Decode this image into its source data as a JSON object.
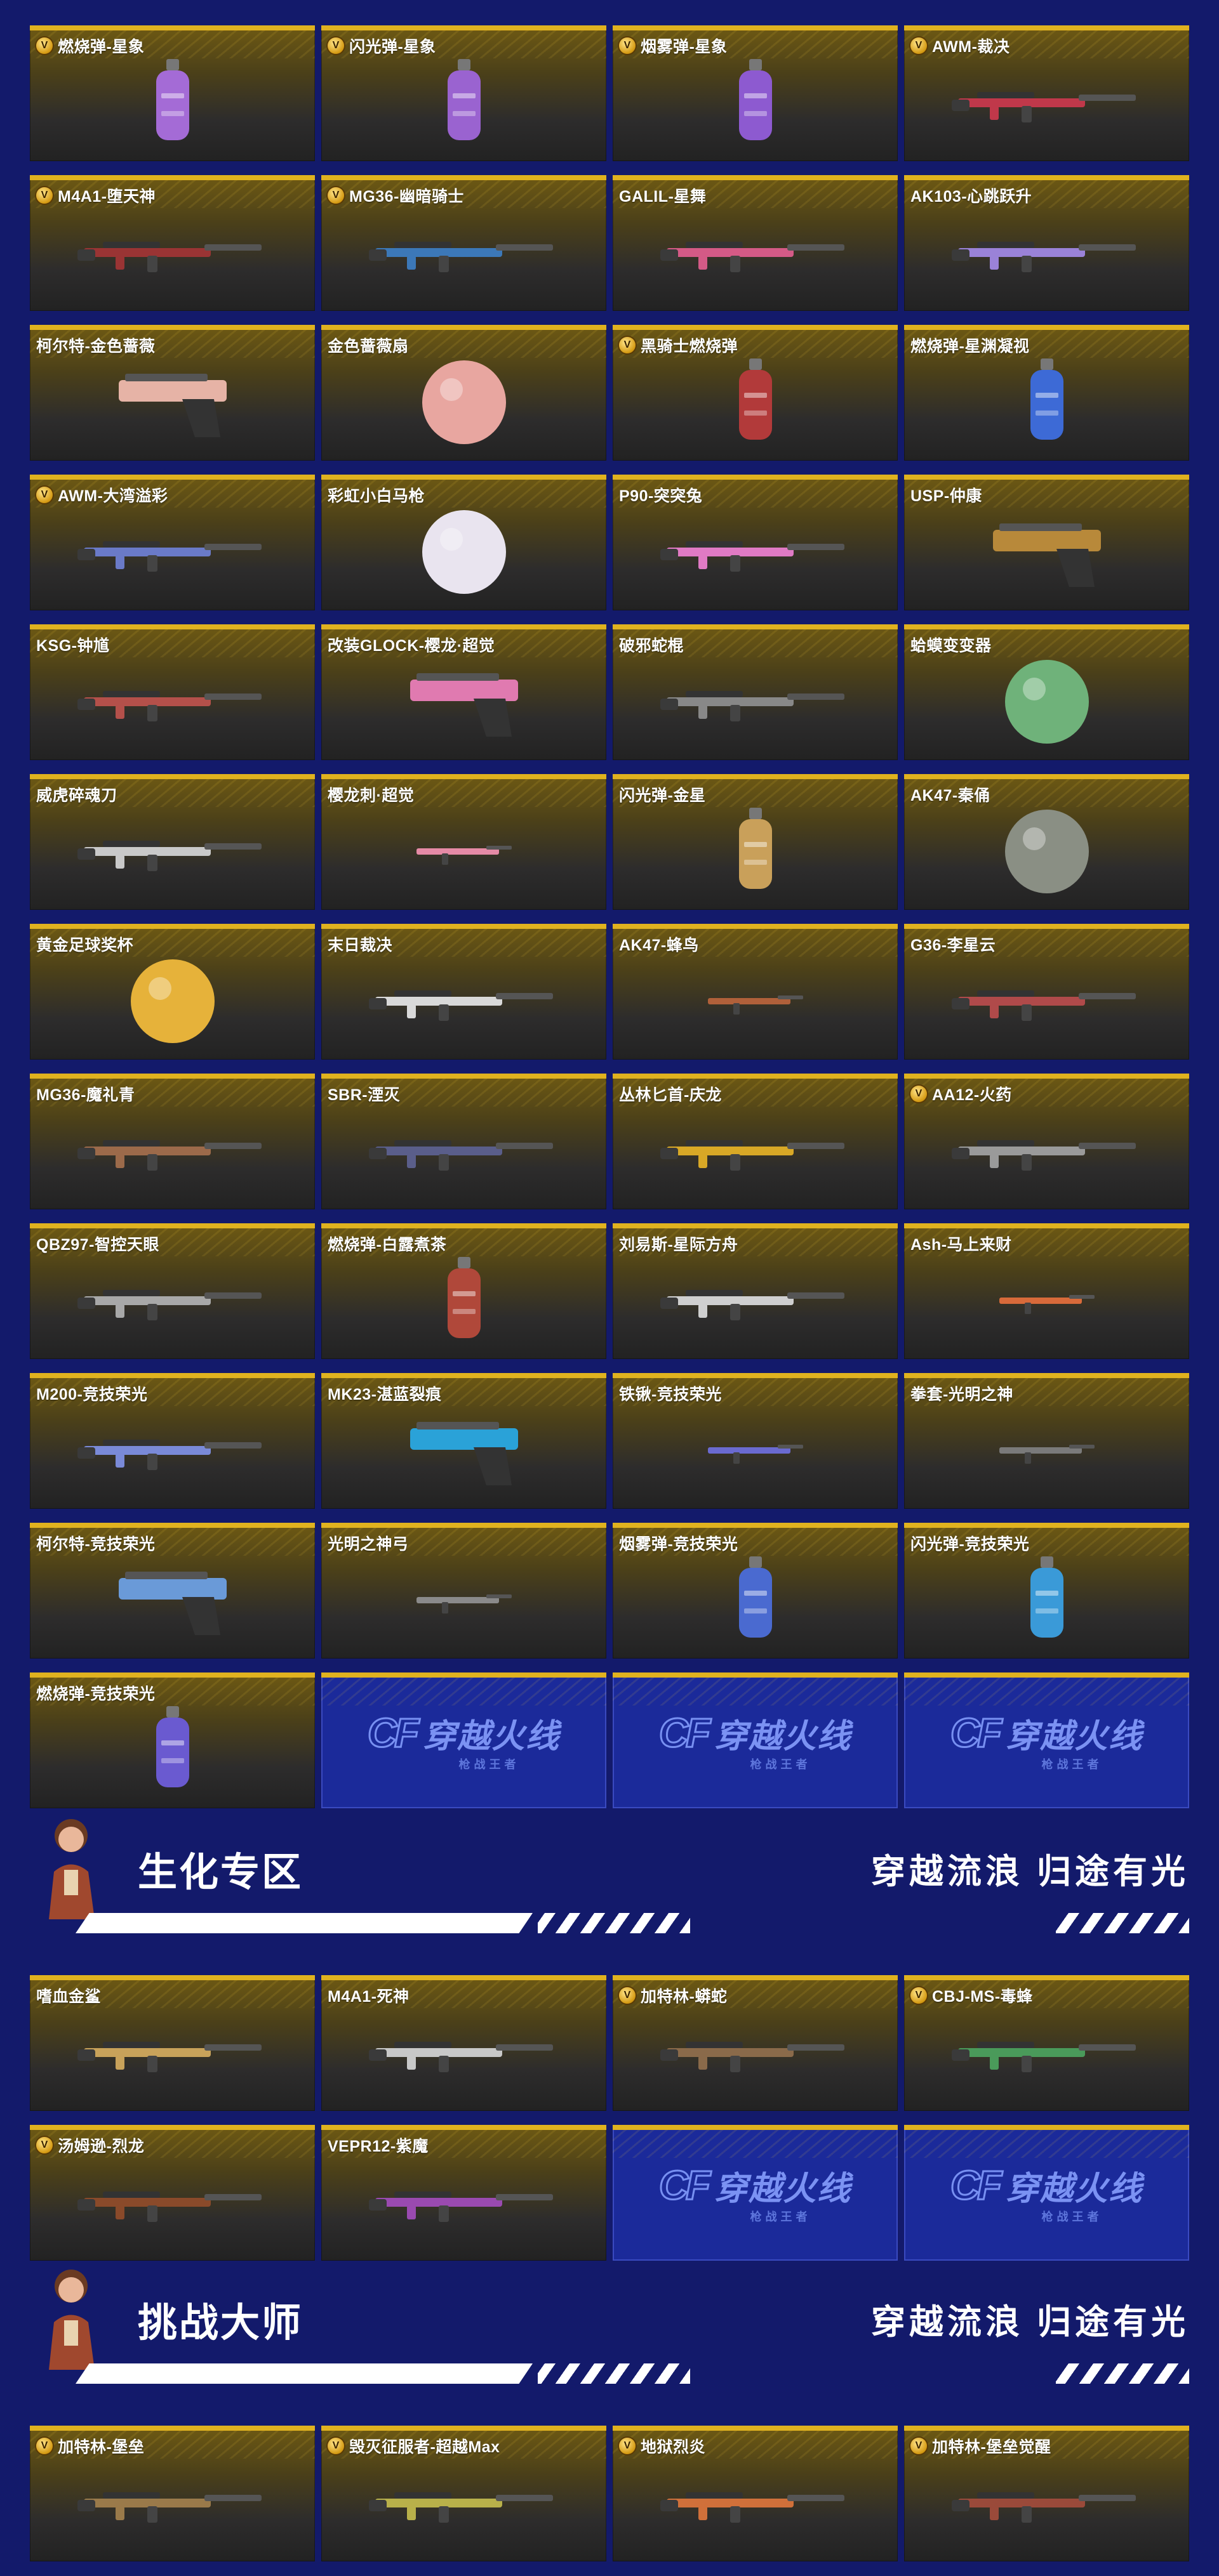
{
  "featured": [
    {
      "name": "燃烧弹-星象",
      "v": true,
      "art": "grenade",
      "color": "#a46bd6"
    },
    {
      "name": "闪光弹-星象",
      "v": true,
      "art": "grenade",
      "color": "#9a63d0"
    },
    {
      "name": "烟雾弹-星象",
      "v": true,
      "art": "grenade",
      "color": "#8d5ad0"
    },
    {
      "name": "AWM-裁决",
      "v": true,
      "art": "gun",
      "color": "#c0384a"
    },
    {
      "name": "M4A1-堕天神",
      "v": true,
      "art": "gun",
      "color": "#9a3434"
    },
    {
      "name": "MG36-幽暗骑士",
      "v": true,
      "art": "gun",
      "color": "#3c78b8"
    },
    {
      "name": "GALIL-星舞",
      "v": false,
      "art": "gun",
      "color": "#d45a86"
    },
    {
      "name": "AK103-心跳跃升",
      "v": false,
      "art": "gun",
      "color": "#9a82d8"
    },
    {
      "name": "柯尔特-金色蔷薇",
      "v": false,
      "art": "pistol",
      "color": "#e6b3a6"
    },
    {
      "name": "金色蔷薇扇",
      "v": false,
      "art": "round",
      "color": "#e8a6a0"
    },
    {
      "name": "黑骑士燃烧弹",
      "v": true,
      "art": "grenade",
      "color": "#b23a3a"
    },
    {
      "name": "燃烧弹-星渊凝视",
      "v": false,
      "art": "grenade",
      "color": "#3d6ad6"
    },
    {
      "name": "AWM-大湾溢彩",
      "v": true,
      "art": "gun",
      "color": "#6a7ac8"
    },
    {
      "name": "彩虹小白马枪",
      "v": false,
      "art": "round",
      "color": "#e9e4ef"
    },
    {
      "name": "P90-突突兔",
      "v": false,
      "art": "gun",
      "color": "#e07ac4"
    },
    {
      "name": "USP-仲康",
      "v": false,
      "art": "pistol",
      "color": "#b8893a"
    },
    {
      "name": "KSG-钟馗",
      "v": false,
      "art": "gun",
      "color": "#b4504a"
    },
    {
      "name": "改装GLOCK-樱龙·超觉",
      "v": false,
      "art": "pistol",
      "color": "#e07ab0"
    },
    {
      "name": "破邪蛇棍",
      "v": false,
      "art": "gun",
      "color": "#888888"
    },
    {
      "name": "蛤蟆变变器",
      "v": false,
      "art": "round",
      "color": "#6fb27a"
    },
    {
      "name": "威虎碎魂刀",
      "v": false,
      "art": "gun",
      "color": "#c9c9c9"
    },
    {
      "name": "樱龙刺·超觉",
      "v": false,
      "art": "small",
      "color": "#e58aa6"
    },
    {
      "name": "闪光弹-金星",
      "v": false,
      "art": "grenade",
      "color": "#c9a05a"
    },
    {
      "name": "AK47-秦俑",
      "v": false,
      "art": "round",
      "color": "#8a8f84"
    },
    {
      "name": "黄金足球奖杯",
      "v": false,
      "art": "round",
      "color": "#e6b23a"
    },
    {
      "name": "末日裁决",
      "v": false,
      "art": "gun",
      "color": "#d9d9d9"
    },
    {
      "name": "AK47-蜂鸟",
      "v": false,
      "art": "small",
      "color": "#b0603a"
    },
    {
      "name": "G36-李星云",
      "v": false,
      "art": "gun",
      "color": "#b04a4a"
    },
    {
      "name": "MG36-魔礼青",
      "v": false,
      "art": "gun",
      "color": "#9c6a4a"
    },
    {
      "name": "SBR-湮灭",
      "v": false,
      "art": "gun",
      "color": "#5a5e8a"
    },
    {
      "name": "丛林匕首-庆龙",
      "v": false,
      "art": "gun",
      "color": "#d8a826"
    },
    {
      "name": "AA12-火药",
      "v": true,
      "art": "gun",
      "color": "#9a9a9a"
    },
    {
      "name": "QBZ97-智控天眼",
      "v": false,
      "art": "gun",
      "color": "#a8a8a8"
    },
    {
      "name": "燃烧弹-白露煮茶",
      "v": false,
      "art": "grenade",
      "color": "#b0483a"
    },
    {
      "name": "刘易斯-星际方舟",
      "v": false,
      "art": "gun",
      "color": "#cfcfcf"
    },
    {
      "name": "Ash-马上来财",
      "v": false,
      "art": "small",
      "color": "#d86a3a"
    },
    {
      "name": "M200-竞技荣光",
      "v": false,
      "art": "gun",
      "color": "#7a8ad8"
    },
    {
      "name": "MK23-湛蓝裂痕",
      "v": false,
      "art": "pistol",
      "color": "#2aa2d8"
    },
    {
      "name": "铁锹-竞技荣光",
      "v": false,
      "art": "small",
      "color": "#6a6ad0"
    },
    {
      "name": "拳套-光明之神",
      "v": false,
      "art": "small",
      "color": "#7a7a7a"
    },
    {
      "name": "柯尔特-竞技荣光",
      "v": false,
      "art": "pistol",
      "color": "#6a9ad8"
    },
    {
      "name": "光明之神弓",
      "v": false,
      "art": "small",
      "color": "#8a8a8a"
    },
    {
      "name": "烟雾弹-竞技荣光",
      "v": false,
      "art": "grenade",
      "color": "#4a6ad0"
    },
    {
      "name": "闪光弹-竞技荣光",
      "v": false,
      "art": "grenade",
      "color": "#3a9ad8"
    },
    {
      "name": "燃烧弹-竞技荣光",
      "v": false,
      "art": "grenade",
      "color": "#6a5ad0"
    }
  ],
  "logo": {
    "cf": "CF",
    "text": "穿越火线",
    "sub": "枪战王者"
  },
  "sections": [
    {
      "title": "生化专区",
      "slogan": "穿越流浪 归途有光"
    },
    {
      "title": "挑战大师",
      "slogan": "穿越流浪 归途有光"
    }
  ],
  "bio_items": [
    {
      "name": "嗜血金鲨",
      "v": false,
      "art": "gun",
      "color": "#c8a25a"
    },
    {
      "name": "M4A1-死神",
      "v": false,
      "art": "gun",
      "color": "#c8c8c8"
    },
    {
      "name": "加特林-蟒蛇",
      "v": true,
      "art": "gun",
      "color": "#8a6a4a"
    },
    {
      "name": "CBJ-MS-毒蜂",
      "v": true,
      "art": "gun",
      "color": "#4a9a5a"
    },
    {
      "name": "汤姆逊-烈龙",
      "v": true,
      "art": "gun",
      "color": "#8a4a2a"
    },
    {
      "name": "VEPR12-紫魔",
      "v": false,
      "art": "gun",
      "color": "#9a4ab0"
    }
  ],
  "master_items": [
    {
      "name": "加特林-堡垒",
      "v": true,
      "art": "gun",
      "color": "#9a7a4a"
    },
    {
      "name": "毁灭征服者-超越Max",
      "v": true,
      "art": "gun",
      "color": "#b8b04a"
    },
    {
      "name": "地狱烈炎",
      "v": true,
      "art": "gun",
      "color": "#d0703a"
    },
    {
      "name": "加特林-堡垒觉醒",
      "v": true,
      "art": "gun",
      "color": "#9a4a3a"
    }
  ]
}
